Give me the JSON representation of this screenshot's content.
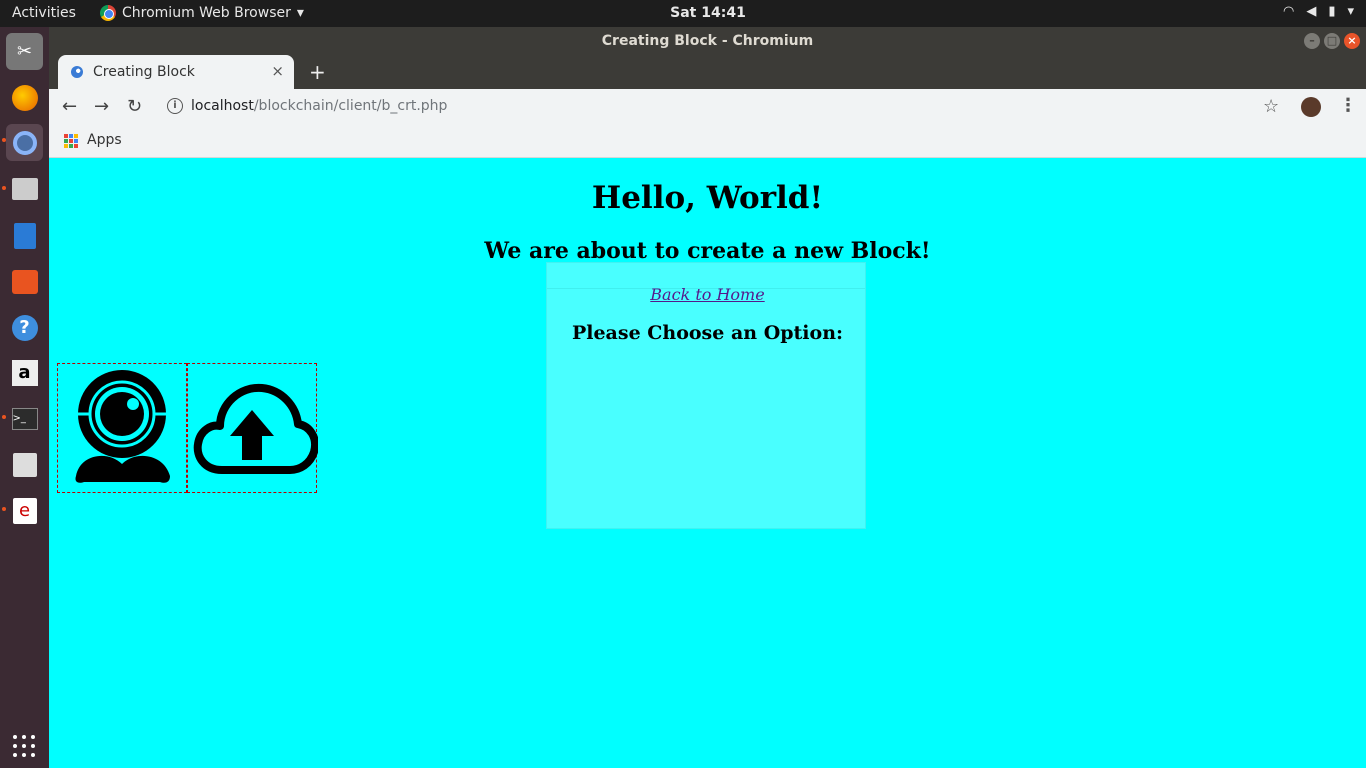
{
  "topbar": {
    "activities": "Activities",
    "app_name": "Chromium Web Browser",
    "clock": "Sat 14:41"
  },
  "window": {
    "title": "Creating Block - Chromium"
  },
  "tab": {
    "title": "Creating Block",
    "close": "×",
    "new_tab": "+"
  },
  "omnibox": {
    "host": "localhost",
    "path": "/blockchain/client/b_crt.php"
  },
  "bookmarks": {
    "apps_label": "Apps"
  },
  "page": {
    "heading": "Hello, World!",
    "subheading": "We are about to create a new Block!",
    "home_link": "Back to Home",
    "prompt": "Please Choose an Option:"
  },
  "colors": {
    "page_background": "#00ffff",
    "option_border": "#bb0000",
    "link": "#551a8b"
  },
  "icons": {
    "option_1": "webcam-icon",
    "option_2": "cloud-upload-icon"
  }
}
